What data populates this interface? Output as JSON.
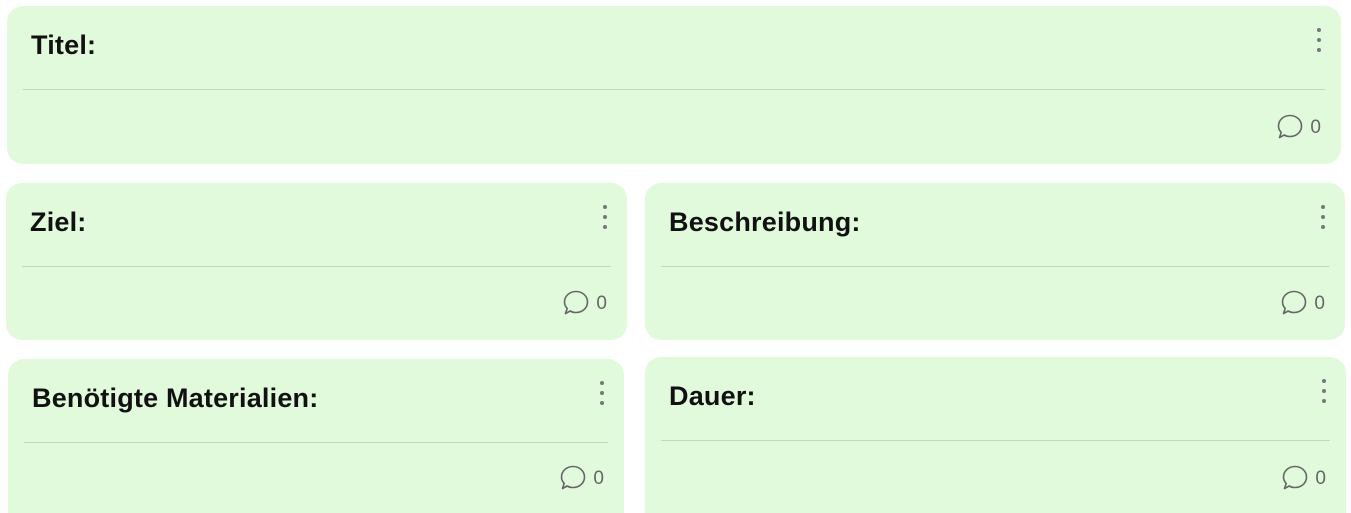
{
  "cards": {
    "titel": {
      "title": "Titel:",
      "comment_count": "0"
    },
    "ziel": {
      "title": "Ziel:",
      "comment_count": "0"
    },
    "beschreibung": {
      "title": "Beschreibung:",
      "comment_count": "0"
    },
    "materialien": {
      "title": "Benötigte Materialien:",
      "comment_count": "0"
    },
    "dauer": {
      "title": "Dauer:",
      "comment_count": "0"
    }
  },
  "icons": {
    "menu": "vertical-ellipsis-icon",
    "comment": "speech-bubble-icon"
  },
  "colors": {
    "card_background": "#e1fadc",
    "title_text": "#111111",
    "muted": "#777777"
  }
}
